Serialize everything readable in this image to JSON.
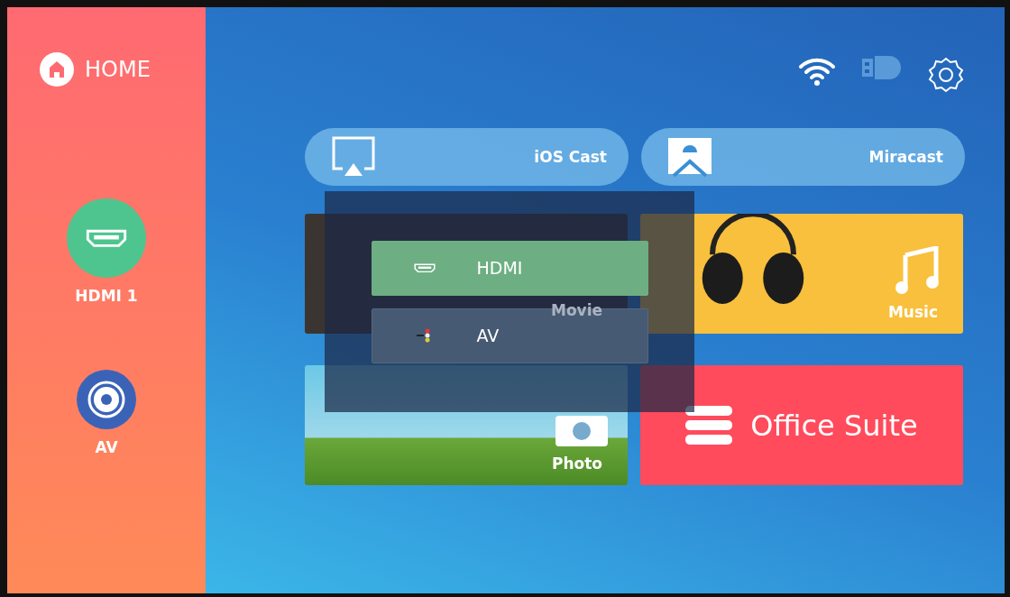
{
  "sidebar": {
    "home": "HOME",
    "inputs": [
      {
        "label": "HDMI 1",
        "kind": "hdmi",
        "color": "#4ec58f"
      },
      {
        "label": "AV",
        "kind": "av",
        "color": "#3a63b8"
      }
    ]
  },
  "status_icons": [
    {
      "kind": "wifi"
    },
    {
      "kind": "usb"
    },
    {
      "kind": "settings"
    }
  ],
  "cast": [
    {
      "label": "iOS Cast",
      "kind": "airplay"
    },
    {
      "label": "Miracast",
      "kind": "android"
    }
  ],
  "tiles": [
    {
      "label": "Movie",
      "kind": "movie"
    },
    {
      "label": "Music",
      "kind": "music"
    },
    {
      "label": "Photo",
      "kind": "photo"
    },
    {
      "label": "Office Suite",
      "kind": "office"
    }
  ],
  "source_menu": [
    {
      "label": "HDMI",
      "kind": "hdmi",
      "selected": true
    },
    {
      "label": "AV",
      "kind": "av",
      "selected": false
    }
  ]
}
